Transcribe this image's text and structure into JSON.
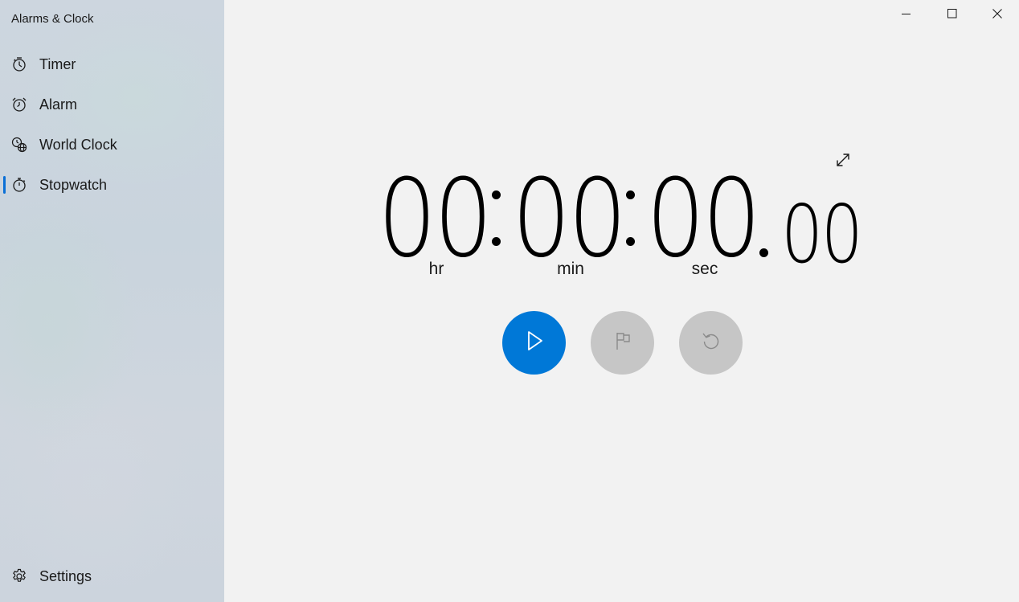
{
  "app": {
    "title": "Alarms & Clock"
  },
  "sidebar": {
    "items": [
      {
        "label": "Timer",
        "icon": "timer-icon"
      },
      {
        "label": "Alarm",
        "icon": "alarm-icon"
      },
      {
        "label": "World Clock",
        "icon": "world-clock-icon"
      },
      {
        "label": "Stopwatch",
        "icon": "stopwatch-icon",
        "selected": true
      }
    ],
    "settings": {
      "label": "Settings",
      "icon": "gear-icon"
    }
  },
  "window_controls": {
    "minimize": "minimize-icon",
    "maximize": "maximize-icon",
    "close": "close-icon"
  },
  "stopwatch": {
    "hours": "00",
    "minutes": "00",
    "seconds": "00",
    "hundredths": "00",
    "separator": ":",
    "units": {
      "hr": "hr",
      "min": "min",
      "sec": "sec"
    },
    "expand_icon": "expand-icon"
  },
  "controls": {
    "start": {
      "icon": "play-icon",
      "color": "#0078d7"
    },
    "lap": {
      "icon": "flag-icon",
      "color": "#c6c6c6"
    },
    "reset": {
      "icon": "reset-icon",
      "color": "#c6c6c6"
    }
  },
  "colors": {
    "accent": "#0078d7",
    "selection_indicator": "#0a6fd6",
    "disabled_button": "#c6c6c6",
    "background": "#f2f2f2"
  }
}
